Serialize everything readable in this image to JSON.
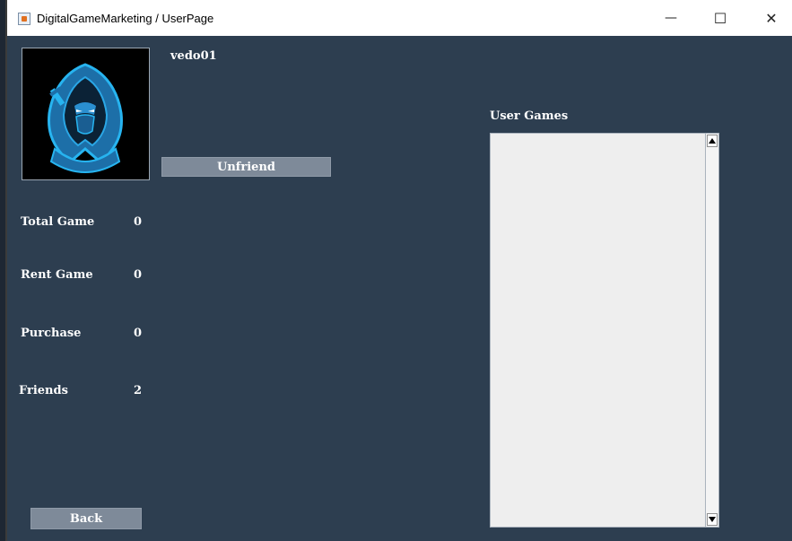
{
  "window": {
    "title": "DigitalGameMarketing / UserPage",
    "minimize_symbol": "—",
    "maximize_symbol": "☐",
    "close_symbol": "✕"
  },
  "user": {
    "username": "vedo01",
    "avatar_icon": "hooded-assassin-logo"
  },
  "actions": {
    "unfriend_label": "Unfriend",
    "back_label": "Back"
  },
  "stats": [
    {
      "label": "Total Game",
      "value": "0"
    },
    {
      "label": "Rent Game",
      "value": "0"
    },
    {
      "label": "Purchase",
      "value": "0"
    },
    {
      "label": "Friends",
      "value": "2"
    }
  ],
  "games": {
    "label": "User Games",
    "items": []
  },
  "colors": {
    "panel_bg": "#2d3e50",
    "button_bg": "#7e8a99",
    "list_bg": "#eeeeee",
    "accent_blue": "#1fa3e0"
  }
}
